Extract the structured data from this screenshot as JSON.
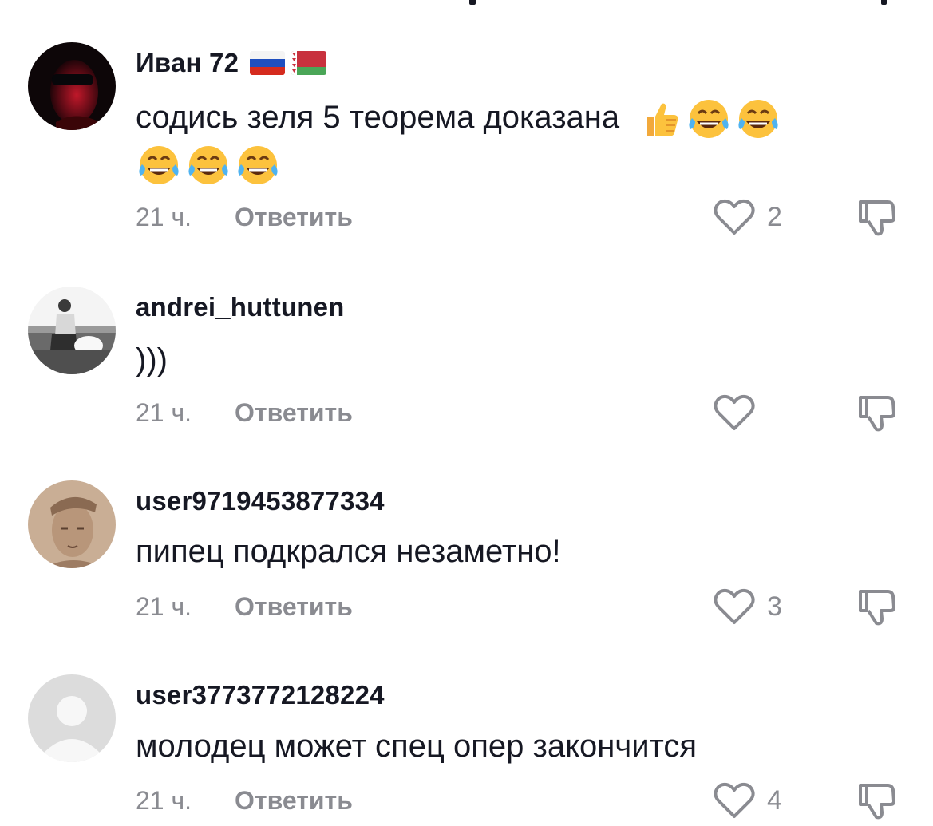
{
  "comments": [
    {
      "username": "Иван 72",
      "flags": [
        "russia-flag",
        "belarus-flag"
      ],
      "text": "содись зеля 5 теорема доказана",
      "emojis_inline": [
        "thumbs-up-emoji",
        "tears-of-joy-emoji",
        "tears-of-joy-emoji"
      ],
      "emojis_wrap": [
        "tears-of-joy-emoji",
        "tears-of-joy-emoji",
        "tears-of-joy-emoji"
      ],
      "time": "21 ч.",
      "reply_label": "Ответить",
      "likes": "2",
      "avatar": "dark-red-portrait"
    },
    {
      "username": "andrei_huttunen",
      "text": ")))",
      "time": "21 ч.",
      "reply_label": "Ответить",
      "likes": "",
      "avatar": "grayscale-seaside-photo"
    },
    {
      "username": "user9719453877334",
      "text": "пипец подкрался незаметно!",
      "time": "21 ч.",
      "reply_label": "Ответить",
      "likes": "3",
      "avatar": "sepia-soldier-portrait"
    },
    {
      "username": "user3773772128224",
      "text": "молодец может спец опер закончится",
      "time": "21 ч.",
      "reply_label": "Ответить",
      "likes": "4",
      "avatar": "default-avatar"
    }
  ],
  "colors": {
    "text": "#161823",
    "muted": "#8a8b91",
    "background": "#ffffff"
  }
}
